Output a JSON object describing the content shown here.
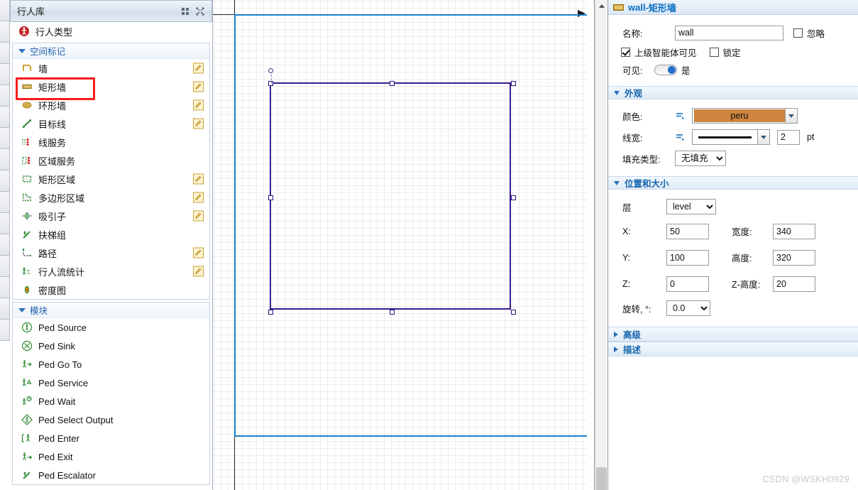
{
  "left_panel": {
    "title": "行人库",
    "header_icons": [
      "grid-view-icon",
      "expand-icon"
    ],
    "top_items": [
      {
        "label": "行人类型",
        "icon": "ped-type-icon",
        "edit": false
      }
    ],
    "groups": [
      {
        "title": "空间标记",
        "items": [
          {
            "label": "墙",
            "icon": "wall-icon",
            "edit": true,
            "highlight": false
          },
          {
            "label": "矩形墙",
            "icon": "rect-wall-icon",
            "edit": true,
            "highlight": true
          },
          {
            "label": "环形墙",
            "icon": "circular-wall-icon",
            "edit": true,
            "highlight": false
          },
          {
            "label": "目标线",
            "icon": "target-line-icon",
            "edit": true,
            "highlight": false
          },
          {
            "label": "线服务",
            "icon": "line-service-icon",
            "edit": false,
            "highlight": false
          },
          {
            "label": "区域服务",
            "icon": "area-service-icon",
            "edit": false,
            "highlight": false
          },
          {
            "label": "矩形区域",
            "icon": "rect-area-icon",
            "edit": true,
            "highlight": false
          },
          {
            "label": "多边形区域",
            "icon": "polygon-area-icon",
            "edit": true,
            "highlight": false
          },
          {
            "label": "吸引子",
            "icon": "attractor-icon",
            "edit": true,
            "highlight": false
          },
          {
            "label": "扶梯组",
            "icon": "escalator-group-icon",
            "edit": false,
            "highlight": false
          },
          {
            "label": "路径",
            "icon": "path-icon",
            "edit": true,
            "highlight": false
          },
          {
            "label": "行人流统计",
            "icon": "ped-flow-statistics-icon",
            "edit": true,
            "highlight": false
          },
          {
            "label": "密度图",
            "icon": "density-map-icon",
            "edit": false,
            "highlight": false
          }
        ]
      },
      {
        "title": "模块",
        "items": [
          {
            "label": "Ped Source",
            "icon": "ped-source-icon",
            "edit": false,
            "highlight": false
          },
          {
            "label": "Ped Sink",
            "icon": "ped-sink-icon",
            "edit": false,
            "highlight": false
          },
          {
            "label": "Ped Go To",
            "icon": "ped-go-to-icon",
            "edit": false,
            "highlight": false
          },
          {
            "label": "Ped Service",
            "icon": "ped-service-icon",
            "edit": false,
            "highlight": false
          },
          {
            "label": "Ped Wait",
            "icon": "ped-wait-icon",
            "edit": false,
            "highlight": false
          },
          {
            "label": "Ped Select Output",
            "icon": "ped-select-output-icon",
            "edit": false,
            "highlight": false
          },
          {
            "label": "Ped Enter",
            "icon": "ped-enter-icon",
            "edit": false,
            "highlight": false
          },
          {
            "label": "Ped Exit",
            "icon": "ped-exit-icon",
            "edit": false,
            "highlight": false
          },
          {
            "label": "Ped Escalator",
            "icon": "ped-escalator-icon",
            "edit": false,
            "highlight": false
          }
        ]
      }
    ]
  },
  "canvas": {
    "selected_shape": "rectangle-wall",
    "scrollbar": {
      "up_arrow": "chevron-up-icon"
    }
  },
  "properties": {
    "title_name": "wall",
    "title_sep": " - ",
    "title_type": "矩形墙",
    "name_label": "名称:",
    "name_value": "wall",
    "ignore_label": "忽略",
    "ignore_checked": false,
    "visible_upper_label": "上级智能体可见",
    "visible_upper_checked": true,
    "lock_label": "锁定",
    "lock_checked": false,
    "visible_label": "可见:",
    "visible_value": "是",
    "sections": {
      "appearance": {
        "title": "外观",
        "color_label": "颜色:",
        "color_value": "peru",
        "color_hex": "#CD853F",
        "linewidth_label": "线宽:",
        "linewidth_value": "2",
        "linewidth_unit": "pt",
        "fill_label": "填充类型:",
        "fill_value": "无填充",
        "fill_options": [
          "无填充"
        ]
      },
      "position_size": {
        "title": "位置和大小",
        "layer_label": "层",
        "layer_value": "level",
        "layer_options": [
          "level"
        ],
        "x_label": "X:",
        "x_value": "50",
        "width_label": "宽度:",
        "width_value": "340",
        "y_label": "Y:",
        "y_value": "100",
        "height_label": "高度:",
        "height_value": "320",
        "z_label": "Z:",
        "z_value": "0",
        "zheight_label": "Z-高度:",
        "zheight_value": "20",
        "rotation_label": "旋转, °:",
        "rotation_value": "0.0",
        "rotation_options": [
          "0.0"
        ]
      },
      "advanced": {
        "title": "高级"
      },
      "description": {
        "title": "描述"
      }
    }
  },
  "watermark": "CSDN @WSKH0929"
}
